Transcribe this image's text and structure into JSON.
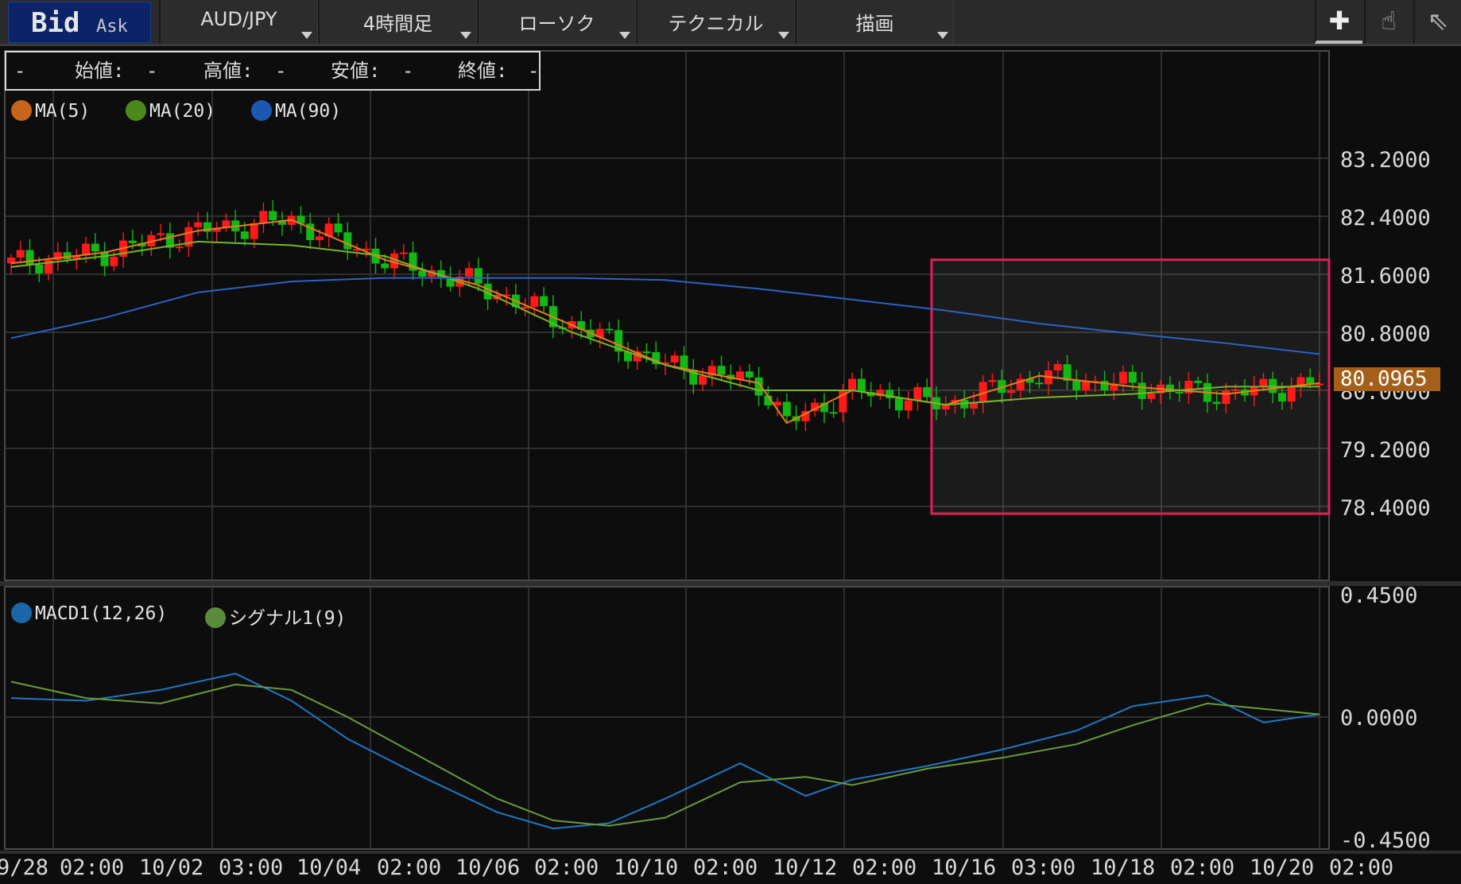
{
  "toolbar": {
    "bid_label": "Bid",
    "ask_label": "Ask",
    "buttons": [
      {
        "label": "AUD/JPY"
      },
      {
        "label": "4時間足"
      },
      {
        "label": "ローソク"
      },
      {
        "label": "テクニカル"
      },
      {
        "label": "描画"
      }
    ],
    "tools": [
      {
        "icon": "crosshair-icon",
        "glyph": "✚"
      },
      {
        "icon": "hand-icon",
        "glyph": "☝"
      },
      {
        "icon": "pointer-icon",
        "glyph": "⇖"
      }
    ]
  },
  "ohlc_box": {
    "date": "-",
    "open_label": "始値:",
    "open_value": "-",
    "high_label": "高値:",
    "high_value": "-",
    "low_label": "安値:",
    "low_value": "-",
    "close_label": "終値:",
    "close_value": "-"
  },
  "legend_main": [
    {
      "label": "MA(5)",
      "color": "#c8641a"
    },
    {
      "label": "MA(20)",
      "color": "#4a8a1a"
    },
    {
      "label": "MA(90)",
      "color": "#1a58b4"
    }
  ],
  "legend_macd": [
    {
      "label": "MACD1(12,26)",
      "color": "#1a66a8"
    },
    {
      "label": "シグナル1(9)",
      "color": "#5a8a3a"
    }
  ],
  "current_price": "80.0965",
  "colors": {
    "up_candle": "#ff1a1a",
    "down_candle": "#14b814",
    "ma5": "#e87d1e",
    "ma20": "#7ab32a",
    "ma90": "#2a62c4",
    "macd": "#1e78c8",
    "signal": "#6a9a3a",
    "highlight": "#e01f5a"
  },
  "chart_data": [
    {
      "type": "candlestick",
      "title": "",
      "y_ticks": [
        "83.2000",
        "82.4000",
        "81.6000",
        "80.8000",
        "80.0000",
        "79.2000",
        "78.4000"
      ],
      "ylim": [
        78.0,
        83.5
      ],
      "x_ticks": [
        "9/28",
        "02:00",
        "10/02",
        "03:00",
        "10/04",
        "02:00",
        "10/06",
        "02:00",
        "10/10",
        "02:00",
        "10/12",
        "02:00",
        "10/16",
        "03:00",
        "10/18",
        "02:00",
        "10/20",
        "02:00"
      ],
      "grid": true,
      "series": [
        {
          "name": "MA(5)",
          "x": [
            0,
            10,
            20,
            30,
            40,
            50,
            60,
            70,
            80,
            83,
            90,
            100,
            110,
            120,
            130,
            140
          ],
          "values": [
            81.75,
            81.9,
            82.2,
            82.35,
            81.8,
            81.45,
            80.9,
            80.35,
            80.1,
            79.55,
            80.0,
            79.8,
            80.2,
            80.05,
            79.95,
            80.1
          ]
        },
        {
          "name": "MA(20)",
          "x": [
            0,
            10,
            20,
            30,
            40,
            50,
            60,
            70,
            80,
            90,
            100,
            110,
            120,
            130,
            140
          ],
          "values": [
            81.7,
            81.85,
            82.05,
            82.0,
            81.85,
            81.4,
            80.8,
            80.35,
            80.0,
            80.0,
            79.8,
            79.9,
            79.95,
            80.05,
            80.05
          ]
        },
        {
          "name": "MA(90)",
          "x": [
            0,
            10,
            20,
            30,
            40,
            50,
            60,
            70,
            80,
            90,
            100,
            110,
            120,
            130,
            140
          ],
          "values": [
            80.72,
            81.0,
            81.35,
            81.5,
            81.55,
            81.55,
            81.55,
            81.52,
            81.4,
            81.25,
            81.1,
            80.92,
            80.78,
            80.65,
            80.5
          ]
        }
      ],
      "highlight": {
        "x_range": [
          99,
          141
        ],
        "y_range": [
          78.3,
          81.8
        ]
      }
    },
    {
      "type": "line",
      "title": "",
      "y_ticks": [
        "0.4500",
        "0.0000",
        "-0.4500"
      ],
      "ylim": [
        -0.45,
        0.45
      ],
      "series": [
        {
          "name": "MACD1(12,26)",
          "x": [
            0,
            8,
            16,
            24,
            30,
            36,
            44,
            52,
            58,
            64,
            70,
            78,
            85,
            90,
            98,
            106,
            114,
            120,
            128,
            134,
            140
          ],
          "values": [
            0.07,
            0.06,
            0.1,
            0.16,
            0.06,
            -0.08,
            -0.22,
            -0.35,
            -0.41,
            -0.39,
            -0.3,
            -0.17,
            -0.29,
            -0.23,
            -0.18,
            -0.12,
            -0.05,
            0.04,
            0.08,
            -0.02,
            0.01
          ]
        },
        {
          "name": "シグナル1(9)",
          "x": [
            0,
            8,
            16,
            24,
            30,
            36,
            44,
            52,
            58,
            64,
            70,
            78,
            85,
            90,
            98,
            106,
            114,
            120,
            128,
            134,
            140
          ],
          "values": [
            0.13,
            0.07,
            0.05,
            0.12,
            0.1,
            0.0,
            -0.15,
            -0.3,
            -0.38,
            -0.4,
            -0.37,
            -0.24,
            -0.22,
            -0.25,
            -0.19,
            -0.15,
            -0.1,
            -0.03,
            0.05,
            0.03,
            0.01
          ]
        }
      ]
    }
  ]
}
